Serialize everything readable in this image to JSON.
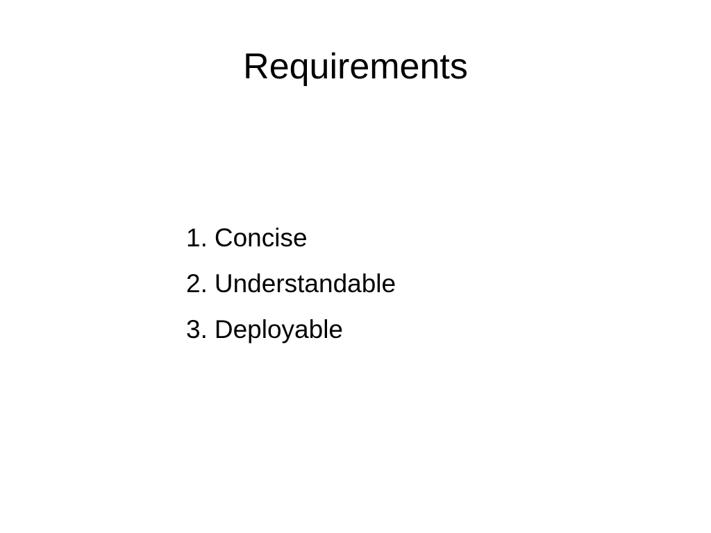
{
  "slide": {
    "title": "Requirements",
    "items": [
      {
        "number": "1.",
        "label": "Concise"
      },
      {
        "number": "2.",
        "label": "Understandable"
      },
      {
        "number": "3.",
        "label": "Deployable"
      }
    ]
  }
}
